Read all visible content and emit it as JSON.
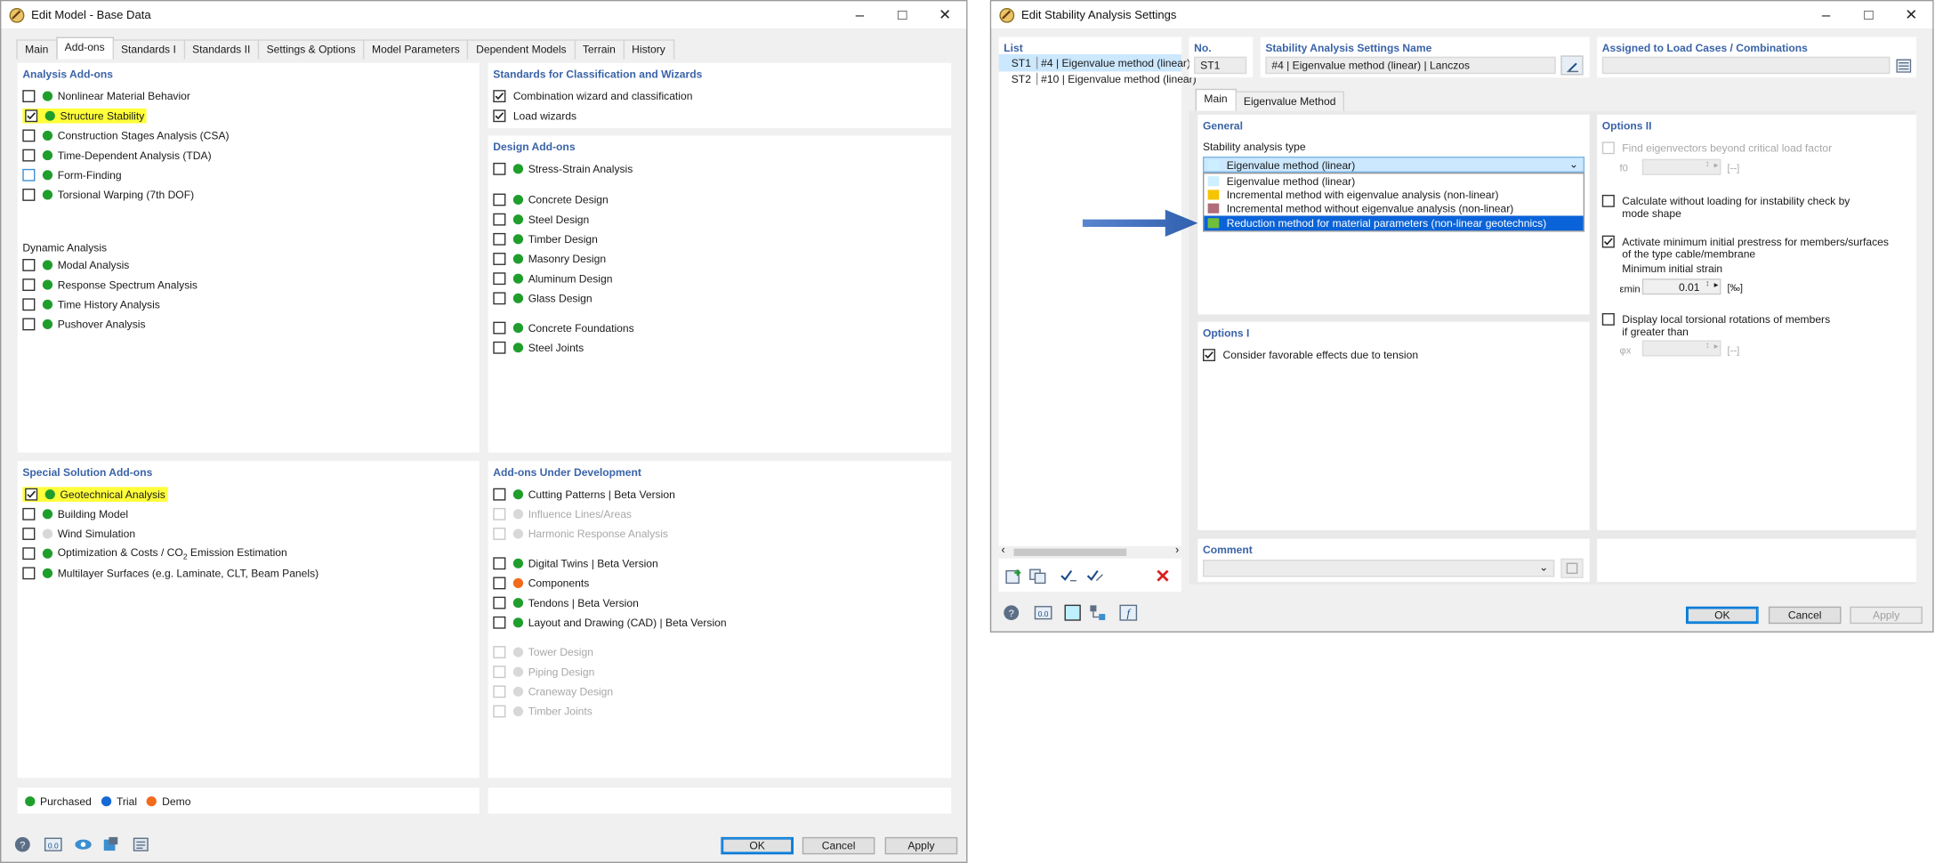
{
  "left_window": {
    "title": "Edit Model - Base Data",
    "tabs": [
      "Main",
      "Add-ons",
      "Standards I",
      "Standards II",
      "Settings & Options",
      "Model Parameters",
      "Dependent Models",
      "Terrain",
      "History"
    ],
    "analysis_addons": {
      "title": "Analysis Add-ons",
      "items": [
        {
          "label": "Nonlinear Material Behavior",
          "checked": false,
          "dot": "#1f9e2c",
          "highlight": false
        },
        {
          "label": "Structure Stability",
          "checked": true,
          "dot": "#1f9e2c",
          "highlight": true
        },
        {
          "label": "Construction Stages Analysis (CSA)",
          "checked": false,
          "dot": "#1f9e2c",
          "highlight": false
        },
        {
          "label": "Time-Dependent Analysis (TDA)",
          "checked": false,
          "dot": "#1f9e2c",
          "highlight": false
        },
        {
          "label": "Form-Finding",
          "checked": false,
          "dot": "#1f9e2c",
          "highlight": false,
          "blue_box": true
        },
        {
          "label": "Torsional Warping (7th DOF)",
          "checked": false,
          "dot": "#1f9e2c",
          "highlight": false
        }
      ]
    },
    "dynamic_analysis": {
      "title": "Dynamic Analysis",
      "items": [
        {
          "label": "Modal Analysis",
          "dot": "#1f9e2c"
        },
        {
          "label": "Response Spectrum Analysis",
          "dot": "#1f9e2c"
        },
        {
          "label": "Time History Analysis",
          "dot": "#1f9e2c"
        },
        {
          "label": "Pushover Analysis",
          "dot": "#1f9e2c"
        }
      ]
    },
    "standards_wizards": {
      "title": "Standards for Classification and Wizards",
      "items": [
        {
          "label": "Combination wizard and classification",
          "checked": true
        },
        {
          "label": "Load wizards",
          "checked": true
        }
      ]
    },
    "design_addons": {
      "title": "Design Add-ons",
      "items": [
        {
          "label": "Stress-Strain Analysis"
        },
        {
          "label": "Concrete Design"
        },
        {
          "label": "Steel Design"
        },
        {
          "label": "Timber Design"
        },
        {
          "label": "Masonry Design"
        },
        {
          "label": "Aluminum Design"
        },
        {
          "label": "Glass Design"
        },
        {
          "label": "Concrete Foundations"
        },
        {
          "label": "Steel Joints"
        }
      ]
    },
    "special_addons": {
      "title": "Special Solution Add-ons",
      "items": [
        {
          "label": "Geotechnical Analysis",
          "checked": true,
          "dot": "#1f9e2c",
          "highlight": true
        },
        {
          "label": "Building Model",
          "checked": false,
          "dot": "#1f9e2c"
        },
        {
          "label": "Wind Simulation",
          "checked": false,
          "dot": "#d8d8d8"
        },
        {
          "label_pre": "Optimization & Costs / CO",
          "label_sub": "2",
          "label_post": " Emission Estimation",
          "checked": false,
          "dot": "#1f9e2c"
        },
        {
          "label": "Multilayer Surfaces (e.g. Laminate, CLT, Beam Panels)",
          "checked": false,
          "dot": "#1f9e2c"
        }
      ]
    },
    "dev_addons": {
      "title": "Add-ons Under Development",
      "items": [
        {
          "label": "Cutting Patterns | Beta Version",
          "dot": "#1f9e2c",
          "disabled": false
        },
        {
          "label": "Influence Lines/Areas",
          "dot": "#d8d8d8",
          "disabled": true
        },
        {
          "label": "Harmonic Response Analysis",
          "dot": "#d8d8d8",
          "disabled": true
        },
        {
          "label": "Digital Twins | Beta Version",
          "dot": "#1f9e2c",
          "disabled": false
        },
        {
          "label": "Components",
          "dot": "#f26b1d",
          "disabled": false
        },
        {
          "label": "Tendons | Beta Version",
          "dot": "#1f9e2c",
          "disabled": false
        },
        {
          "label": "Layout and Drawing (CAD) | Beta Version",
          "dot": "#1f9e2c",
          "disabled": false
        },
        {
          "label": "Tower Design",
          "dot": "#d8d8d8",
          "disabled": true
        },
        {
          "label": "Piping Design",
          "dot": "#d8d8d8",
          "disabled": true
        },
        {
          "label": "Craneway Design",
          "dot": "#d8d8d8",
          "disabled": true
        },
        {
          "label": "Timber Joints",
          "dot": "#d8d8d8",
          "disabled": true
        }
      ]
    },
    "legend": [
      {
        "label": "Purchased",
        "color": "#1f9e2c"
      },
      {
        "label": "Trial",
        "color": "#1769d6"
      },
      {
        "label": "Demo",
        "color": "#f26b1d"
      }
    ],
    "buttons": {
      "ok": "OK",
      "cancel": "Cancel",
      "apply": "Apply"
    }
  },
  "right_window": {
    "title": "Edit Stability Analysis Settings",
    "list_title": "List",
    "list": [
      {
        "id": "ST1",
        "label": "#4 | Eigenvalue method (linear)",
        "color": "#a8dcf6"
      },
      {
        "id": "ST2",
        "label": "#10 | Eigenvalue method (linear)",
        "color": "#f5c400"
      }
    ],
    "no_label": "No.",
    "no_value": "ST1",
    "name_label": "Stability Analysis Settings Name",
    "name_value": "#4 | Eigenvalue method (linear) | Lanczos",
    "assigned_label": "Assigned to Load Cases / Combinations",
    "tabs": [
      "Main",
      "Eigenvalue Method"
    ],
    "general_title": "General",
    "type_label": "Stability analysis type",
    "selected": "Eigenvalue method (linear)",
    "options": [
      {
        "label": "Eigenvalue method (linear)",
        "color": "#ccf0ff"
      },
      {
        "label": "Incremental method with eigenvalue analysis (non-linear)",
        "color": "#f5c400"
      },
      {
        "label": "Incremental method without eigenvalue analysis (non-linear)",
        "color": "#b06c78"
      },
      {
        "label": "Reduction method for material parameters (non-linear geotechnics)",
        "color": "#6fbf3a"
      }
    ],
    "options1_title": "Options I",
    "favorable_label": "Consider favorable effects due to tension",
    "options2_title": "Options II",
    "find_eig_label": "Find eigenvectors beyond critical load factor",
    "f0_label": "f0",
    "unit_dash": "[--]",
    "calc_without_line1": "Calculate without loading for instability check by",
    "calc_without_line2": "mode shape",
    "activate_line1": "Activate minimum initial prestress for members/surfaces",
    "activate_line2": "of the type cable/membrane",
    "min_strain_label": "Minimum initial strain",
    "emin_label": "εmin",
    "emin_value": "0.01",
    "emin_unit": "[‰]",
    "display_line1": "Display local torsional rotations of members",
    "display_line2": "if greater than",
    "phi_label": "φx",
    "comment_label": "Comment",
    "buttons": {
      "ok": "OK",
      "cancel": "Cancel",
      "apply": "Apply"
    }
  }
}
